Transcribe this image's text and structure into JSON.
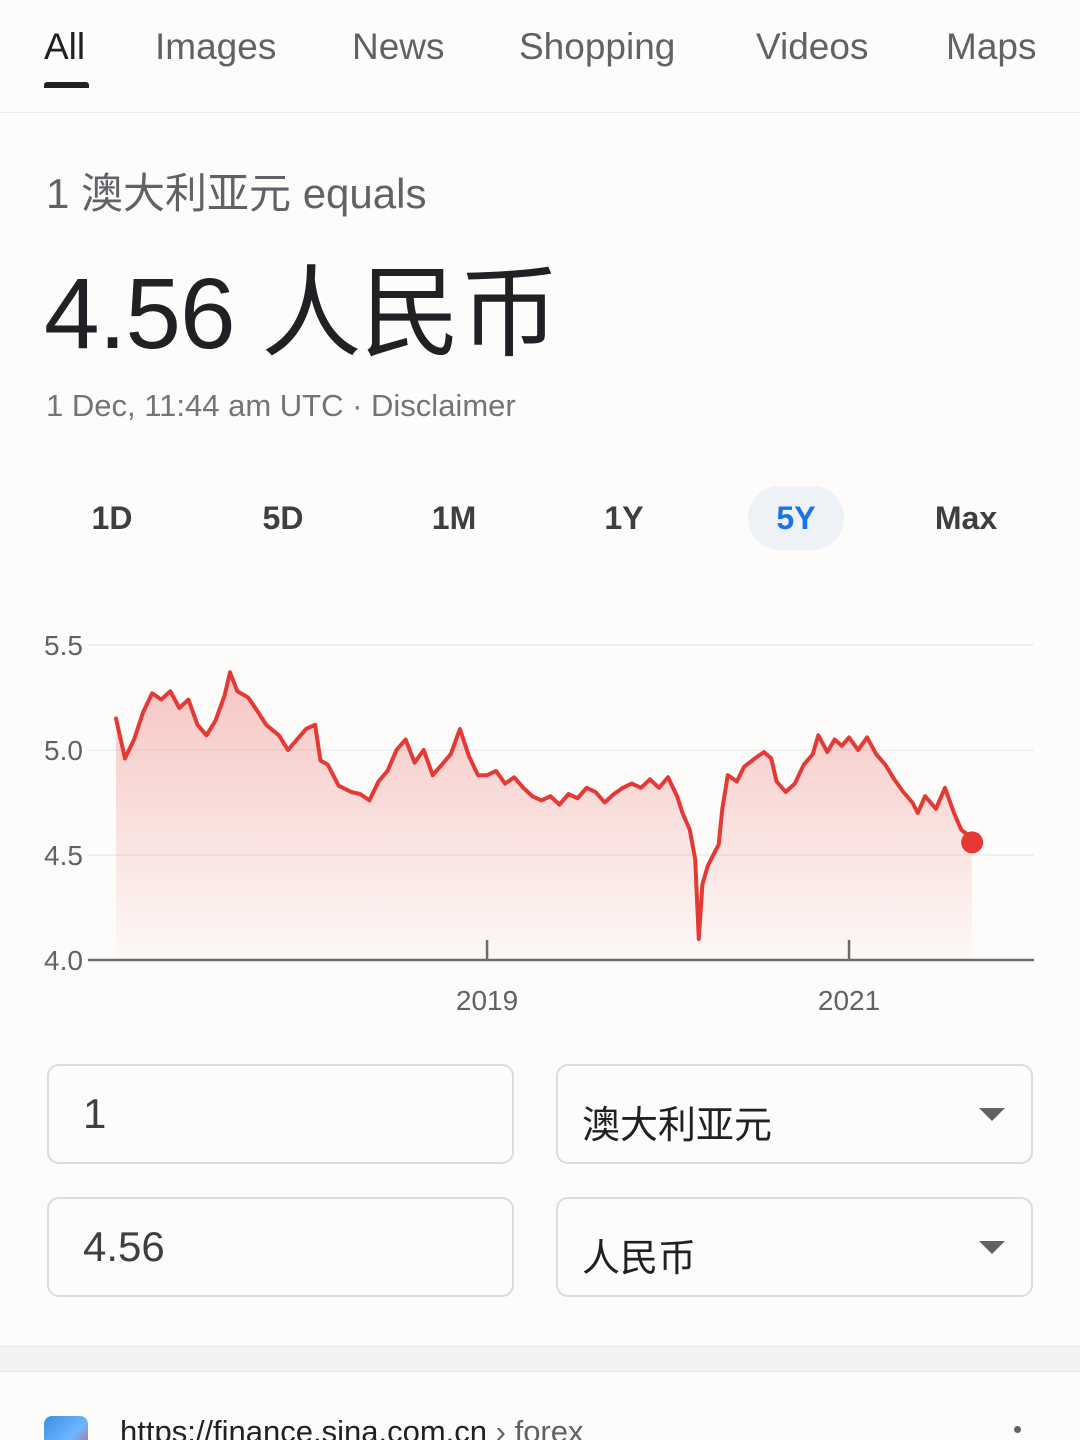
{
  "tabs": [
    {
      "label": "All",
      "active": true
    },
    {
      "label": "Images"
    },
    {
      "label": "News"
    },
    {
      "label": "Shopping"
    },
    {
      "label": "Videos"
    },
    {
      "label": "Maps"
    }
  ],
  "converter": {
    "equals_line": "1 澳大利亚元 equals",
    "result": "4.56 人民币",
    "timestamp": "1 Dec, 11:44 am UTC · Disclaimer"
  },
  "ranges": [
    {
      "label": "1D"
    },
    {
      "label": "5D"
    },
    {
      "label": "1M"
    },
    {
      "label": "1Y"
    },
    {
      "label": "5Y",
      "active": true
    },
    {
      "label": "Max"
    }
  ],
  "colors": {
    "line": "#e53935",
    "accent": "#1a73e8"
  },
  "chart_data": {
    "type": "area",
    "ylim": [
      4.0,
      5.5
    ],
    "yticks": [
      "5.5",
      "5.0",
      "4.5",
      "4.0"
    ],
    "xtick_labels": [
      {
        "label": "2019",
        "x": 2019.0
      },
      {
        "label": "2021",
        "x": 2021.0
      }
    ],
    "xlim": [
      2016.95,
      2021.95
    ],
    "grid": true,
    "series": [
      {
        "points": [
          [
            2016.95,
            5.15
          ],
          [
            2017.0,
            4.96
          ],
          [
            2017.05,
            5.05
          ],
          [
            2017.1,
            5.18
          ],
          [
            2017.15,
            5.27
          ],
          [
            2017.2,
            5.24
          ],
          [
            2017.25,
            5.28
          ],
          [
            2017.3,
            5.2
          ],
          [
            2017.35,
            5.24
          ],
          [
            2017.4,
            5.12
          ],
          [
            2017.45,
            5.07
          ],
          [
            2017.5,
            5.14
          ],
          [
            2017.55,
            5.26
          ],
          [
            2017.58,
            5.37
          ],
          [
            2017.62,
            5.28
          ],
          [
            2017.68,
            5.25
          ],
          [
            2017.72,
            5.2
          ],
          [
            2017.78,
            5.12
          ],
          [
            2017.85,
            5.07
          ],
          [
            2017.9,
            5.0
          ],
          [
            2017.95,
            5.05
          ],
          [
            2018.0,
            5.1
          ],
          [
            2018.05,
            5.12
          ],
          [
            2018.08,
            4.95
          ],
          [
            2018.12,
            4.93
          ],
          [
            2018.18,
            4.83
          ],
          [
            2018.25,
            4.8
          ],
          [
            2018.3,
            4.79
          ],
          [
            2018.35,
            4.76
          ],
          [
            2018.4,
            4.85
          ],
          [
            2018.45,
            4.9
          ],
          [
            2018.5,
            5.0
          ],
          [
            2018.55,
            5.05
          ],
          [
            2018.6,
            4.94
          ],
          [
            2018.65,
            5.0
          ],
          [
            2018.7,
            4.88
          ],
          [
            2018.75,
            4.93
          ],
          [
            2018.8,
            4.98
          ],
          [
            2018.85,
            5.1
          ],
          [
            2018.9,
            4.97
          ],
          [
            2018.95,
            4.88
          ],
          [
            2019.0,
            4.88
          ],
          [
            2019.05,
            4.9
          ],
          [
            2019.1,
            4.84
          ],
          [
            2019.15,
            4.87
          ],
          [
            2019.2,
            4.82
          ],
          [
            2019.25,
            4.78
          ],
          [
            2019.3,
            4.76
          ],
          [
            2019.35,
            4.78
          ],
          [
            2019.4,
            4.74
          ],
          [
            2019.45,
            4.79
          ],
          [
            2019.5,
            4.77
          ],
          [
            2019.55,
            4.82
          ],
          [
            2019.6,
            4.8
          ],
          [
            2019.65,
            4.75
          ],
          [
            2019.7,
            4.79
          ],
          [
            2019.75,
            4.82
          ],
          [
            2019.8,
            4.84
          ],
          [
            2019.85,
            4.82
          ],
          [
            2019.9,
            4.86
          ],
          [
            2019.95,
            4.82
          ],
          [
            2020.0,
            4.87
          ],
          [
            2020.05,
            4.78
          ],
          [
            2020.08,
            4.7
          ],
          [
            2020.12,
            4.62
          ],
          [
            2020.15,
            4.48
          ],
          [
            2020.17,
            4.1
          ],
          [
            2020.19,
            4.36
          ],
          [
            2020.22,
            4.45
          ],
          [
            2020.25,
            4.5
          ],
          [
            2020.28,
            4.55
          ],
          [
            2020.3,
            4.72
          ],
          [
            2020.33,
            4.88
          ],
          [
            2020.38,
            4.85
          ],
          [
            2020.42,
            4.92
          ],
          [
            2020.48,
            4.96
          ],
          [
            2020.53,
            4.99
          ],
          [
            2020.57,
            4.96
          ],
          [
            2020.6,
            4.85
          ],
          [
            2020.65,
            4.8
          ],
          [
            2020.7,
            4.84
          ],
          [
            2020.75,
            4.93
          ],
          [
            2020.8,
            4.98
          ],
          [
            2020.83,
            5.07
          ],
          [
            2020.88,
            4.99
          ],
          [
            2020.92,
            5.05
          ],
          [
            2020.96,
            5.02
          ],
          [
            2021.0,
            5.06
          ],
          [
            2021.05,
            5.0
          ],
          [
            2021.1,
            5.06
          ],
          [
            2021.15,
            4.98
          ],
          [
            2021.2,
            4.93
          ],
          [
            2021.25,
            4.86
          ],
          [
            2021.3,
            4.8
          ],
          [
            2021.35,
            4.75
          ],
          [
            2021.38,
            4.7
          ],
          [
            2021.42,
            4.78
          ],
          [
            2021.48,
            4.72
          ],
          [
            2021.53,
            4.82
          ],
          [
            2021.58,
            4.7
          ],
          [
            2021.62,
            4.62
          ],
          [
            2021.65,
            4.6
          ],
          [
            2021.68,
            4.56
          ]
        ]
      }
    ]
  },
  "amount_input": {
    "value": "1"
  },
  "from_currency": {
    "value": "澳大利亚元"
  },
  "result_input": {
    "value": "4.56"
  },
  "to_currency": {
    "value": "人民币"
  },
  "search_result": {
    "url": "https://finance.sina.com.cn",
    "path": " › forex"
  }
}
